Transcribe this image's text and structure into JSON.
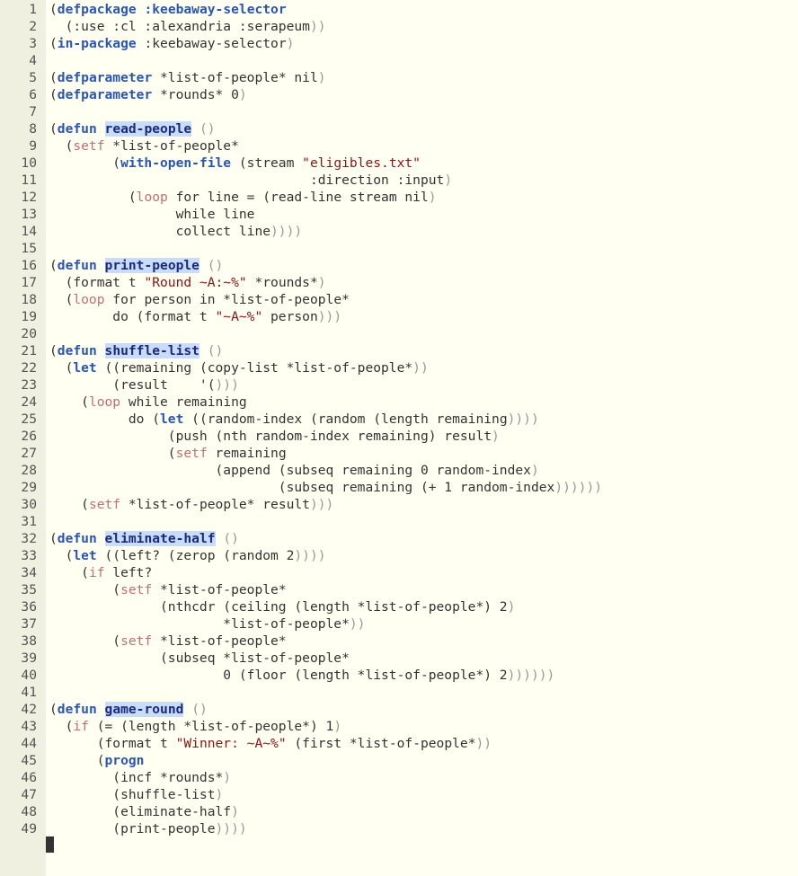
{
  "editor": {
    "lines": [
      [
        {
          "t": "(",
          "c": ""
        },
        {
          "t": "defpackage",
          "c": "kw"
        },
        {
          "t": " ",
          "c": ""
        },
        {
          "t": ":keebaway-selector",
          "c": "kw"
        }
      ],
      [
        {
          "t": "  (:use :cl :alexandria :serapeum",
          "c": ""
        },
        {
          "t": "))",
          "c": "p"
        }
      ],
      [
        {
          "t": "(",
          "c": ""
        },
        {
          "t": "in-package",
          "c": "kw"
        },
        {
          "t": " :keebaway-selector",
          "c": ""
        },
        {
          "t": ")",
          "c": "p"
        }
      ],
      [],
      [
        {
          "t": "(",
          "c": ""
        },
        {
          "t": "defparameter",
          "c": "kw"
        },
        {
          "t": " *list-of-people* nil",
          "c": ""
        },
        {
          "t": ")",
          "c": "p"
        }
      ],
      [
        {
          "t": "(",
          "c": ""
        },
        {
          "t": "defparameter",
          "c": "kw"
        },
        {
          "t": " *rounds* 0",
          "c": ""
        },
        {
          "t": ")",
          "c": "p"
        }
      ],
      [],
      [
        {
          "t": "(",
          "c": ""
        },
        {
          "t": "defun",
          "c": "kw"
        },
        {
          "t": " ",
          "c": ""
        },
        {
          "t": "read-people",
          "c": "fn"
        },
        {
          "t": " ",
          "c": ""
        },
        {
          "t": "()",
          "c": "p"
        }
      ],
      [
        {
          "t": "  (",
          "c": ""
        },
        {
          "t": "setf",
          "c": "mac"
        },
        {
          "t": " *list-of-people*",
          "c": ""
        }
      ],
      [
        {
          "t": "        (",
          "c": ""
        },
        {
          "t": "with-open-file",
          "c": "kw"
        },
        {
          "t": " (stream ",
          "c": ""
        },
        {
          "t": "\"eligibles.txt\"",
          "c": "str"
        }
      ],
      [
        {
          "t": "                                 :direction :input",
          "c": ""
        },
        {
          "t": ")",
          "c": "p"
        }
      ],
      [
        {
          "t": "          (",
          "c": ""
        },
        {
          "t": "loop",
          "c": "mac"
        },
        {
          "t": " for line = (read-line stream nil",
          "c": ""
        },
        {
          "t": ")",
          "c": "p"
        }
      ],
      [
        {
          "t": "                while line",
          "c": ""
        }
      ],
      [
        {
          "t": "                collect line",
          "c": ""
        },
        {
          "t": "))))",
          "c": "p"
        }
      ],
      [],
      [
        {
          "t": "(",
          "c": ""
        },
        {
          "t": "defun",
          "c": "kw"
        },
        {
          "t": " ",
          "c": ""
        },
        {
          "t": "print-people",
          "c": "fn"
        },
        {
          "t": " ",
          "c": ""
        },
        {
          "t": "()",
          "c": "p"
        }
      ],
      [
        {
          "t": "  (format t ",
          "c": ""
        },
        {
          "t": "\"Round ~A:~%\"",
          "c": "str"
        },
        {
          "t": " *rounds*",
          "c": ""
        },
        {
          "t": ")",
          "c": "p"
        }
      ],
      [
        {
          "t": "  (",
          "c": ""
        },
        {
          "t": "loop",
          "c": "mac"
        },
        {
          "t": " for person in *list-of-people*",
          "c": ""
        }
      ],
      [
        {
          "t": "        do (format t ",
          "c": ""
        },
        {
          "t": "\"~A~%\"",
          "c": "str"
        },
        {
          "t": " person",
          "c": ""
        },
        {
          "t": ")))",
          "c": "p"
        }
      ],
      [],
      [
        {
          "t": "(",
          "c": ""
        },
        {
          "t": "defun",
          "c": "kw"
        },
        {
          "t": " ",
          "c": ""
        },
        {
          "t": "shuffle-list",
          "c": "fn"
        },
        {
          "t": " ",
          "c": ""
        },
        {
          "t": "()",
          "c": "p"
        }
      ],
      [
        {
          "t": "  (",
          "c": ""
        },
        {
          "t": "let",
          "c": "kw"
        },
        {
          "t": " ((remaining (copy-list *list-of-people*",
          "c": ""
        },
        {
          "t": "))",
          "c": "p"
        }
      ],
      [
        {
          "t": "        (result    '(",
          "c": ""
        },
        {
          "t": ")))",
          "c": "p"
        }
      ],
      [
        {
          "t": "    (",
          "c": ""
        },
        {
          "t": "loop",
          "c": "mac"
        },
        {
          "t": " while remaining",
          "c": ""
        }
      ],
      [
        {
          "t": "          do (",
          "c": ""
        },
        {
          "t": "let",
          "c": "kw"
        },
        {
          "t": " ((random-index (random (length remaining",
          "c": ""
        },
        {
          "t": "))))",
          "c": "p"
        }
      ],
      [
        {
          "t": "               (push (nth random-index remaining) result",
          "c": ""
        },
        {
          "t": ")",
          "c": "p"
        }
      ],
      [
        {
          "t": "               (",
          "c": ""
        },
        {
          "t": "setf",
          "c": "mac"
        },
        {
          "t": " remaining",
          "c": ""
        }
      ],
      [
        {
          "t": "                     (append (subseq remaining 0 random-index",
          "c": ""
        },
        {
          "t": ")",
          "c": "p"
        }
      ],
      [
        {
          "t": "                             (subseq remaining (+ 1 random-index",
          "c": ""
        },
        {
          "t": "))))))",
          "c": "p"
        }
      ],
      [
        {
          "t": "    (",
          "c": ""
        },
        {
          "t": "setf",
          "c": "mac"
        },
        {
          "t": " *list-of-people* result",
          "c": ""
        },
        {
          "t": ")))",
          "c": "p"
        }
      ],
      [],
      [
        {
          "t": "(",
          "c": ""
        },
        {
          "t": "defun",
          "c": "kw"
        },
        {
          "t": " ",
          "c": ""
        },
        {
          "t": "eliminate-half",
          "c": "fn"
        },
        {
          "t": " ",
          "c": ""
        },
        {
          "t": "()",
          "c": "p"
        }
      ],
      [
        {
          "t": "  (",
          "c": ""
        },
        {
          "t": "let",
          "c": "kw"
        },
        {
          "t": " ((left? (zerop (random 2",
          "c": ""
        },
        {
          "t": "))))",
          "c": "p"
        }
      ],
      [
        {
          "t": "    (",
          "c": ""
        },
        {
          "t": "if",
          "c": "mac"
        },
        {
          "t": " left?",
          "c": ""
        }
      ],
      [
        {
          "t": "        (",
          "c": ""
        },
        {
          "t": "setf",
          "c": "mac"
        },
        {
          "t": " *list-of-people*",
          "c": ""
        }
      ],
      [
        {
          "t": "              (nthcdr (ceiling (length *list-of-people*) 2",
          "c": ""
        },
        {
          "t": ")",
          "c": "p"
        }
      ],
      [
        {
          "t": "                      *list-of-people*",
          "c": ""
        },
        {
          "t": "))",
          "c": "p"
        }
      ],
      [
        {
          "t": "        (",
          "c": ""
        },
        {
          "t": "setf",
          "c": "mac"
        },
        {
          "t": " *list-of-people*",
          "c": ""
        }
      ],
      [
        {
          "t": "              (subseq *list-of-people*",
          "c": ""
        }
      ],
      [
        {
          "t": "                      0 (floor (length *list-of-people*) 2",
          "c": ""
        },
        {
          "t": "))))))",
          "c": "p"
        }
      ],
      [],
      [
        {
          "t": "(",
          "c": ""
        },
        {
          "t": "defun",
          "c": "kw"
        },
        {
          "t": " ",
          "c": ""
        },
        {
          "t": "game-round",
          "c": "fn"
        },
        {
          "t": " ",
          "c": ""
        },
        {
          "t": "()",
          "c": "p"
        }
      ],
      [
        {
          "t": "  (",
          "c": ""
        },
        {
          "t": "if",
          "c": "mac"
        },
        {
          "t": " (= (length *list-of-people*) 1",
          "c": ""
        },
        {
          "t": ")",
          "c": "p"
        }
      ],
      [
        {
          "t": "      (format t ",
          "c": ""
        },
        {
          "t": "\"Winner: ~A~%\"",
          "c": "str"
        },
        {
          "t": " (first *list-of-people*",
          "c": ""
        },
        {
          "t": "))",
          "c": "p"
        }
      ],
      [
        {
          "t": "      (",
          "c": ""
        },
        {
          "t": "progn",
          "c": "kw"
        }
      ],
      [
        {
          "t": "        (incf *rounds*",
          "c": ""
        },
        {
          "t": ")",
          "c": "p"
        }
      ],
      [
        {
          "t": "        (shuffle-list",
          "c": ""
        },
        {
          "t": ")",
          "c": "p"
        }
      ],
      [
        {
          "t": "        (eliminate-half",
          "c": ""
        },
        {
          "t": ")",
          "c": "p"
        }
      ],
      [
        {
          "t": "        (print-people",
          "c": ""
        },
        {
          "t": "))))",
          "c": "p"
        }
      ]
    ],
    "colors": {
      "background": "#fffff2",
      "gutter": "#f0f0e0",
      "keyword": "#2a55b0",
      "macro": "#c07070",
      "function_highlight": "#c9dcfb",
      "string": "#8a1414"
    }
  }
}
